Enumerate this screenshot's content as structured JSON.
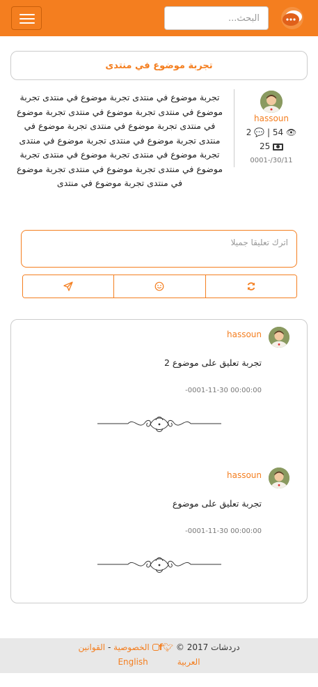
{
  "header": {
    "search_placeholder": "البحث...",
    "colors": {
      "accent": "#f47e1f"
    }
  },
  "topic": {
    "title": "تجربة موضوع في منتدى",
    "author": "hassoun",
    "views": "54",
    "comments_count": "2",
    "points": "25",
    "date": "0001-/30/11",
    "body": "تجربة موضوع في منتدى تجربة موضوع في منتدى تجربة موضوع في منتدى تجربة موضوع في منتدى تجربة موضوع في منتدى تجربة موضوع في منتدى تجربة موضوع في منتدى تجربة موضوع في منتدى تجربة موضوع في منتدى تجربة موضوع في منتدى تجربة موضوع في منتدى تجربة موضوع في منتدى تجربة موضوع في منتدى تجربة موضوع في منتدى تجربة موضوع في منتدى"
  },
  "comment_form": {
    "placeholder": "اترك تعليقا جميلا",
    "buttons": [
      "send-icon",
      "smiley-icon",
      "refresh-icon"
    ]
  },
  "comments": [
    {
      "author": "hassoun",
      "text": "تجربة تعليق على موضوع 2",
      "date": "-0001-11-30 00:00:00"
    },
    {
      "author": "hassoun",
      "text": "تجربة تعليق على موضوع",
      "date": "-0001-11-30 00:00:00"
    }
  ],
  "footer": {
    "brand": "دردشات",
    "year": "2017 ©",
    "privacy": "الخصوصية",
    "rules": "القوانين",
    "separator": "-",
    "lang_ar": "العربية",
    "lang_en": "English",
    "social": [
      "twitter-icon",
      "facebook-icon",
      "instagram-icon"
    ]
  }
}
